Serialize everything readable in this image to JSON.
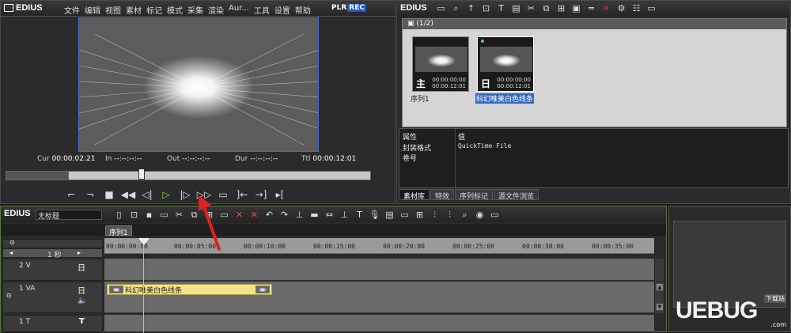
{
  "player": {
    "logo": "EDIUS",
    "menu": [
      "文件",
      "编辑",
      "视图",
      "素材",
      "标记",
      "模式",
      "采集",
      "渲染",
      "Aur...",
      "工具",
      "设置",
      "帮助"
    ],
    "plr": "PLR",
    "rec": "REC",
    "window_buttons": [
      "_",
      "□",
      "×"
    ],
    "timecodes": {
      "cur_label": "Cur",
      "cur": "00:00:02:21",
      "in_label": "In",
      "in": "--:--:--:--",
      "out_label": "Out",
      "out": "--:--:--:--",
      "dur_label": "Dur",
      "dur": "--:--:--:--",
      "ttl_label": "Ttl",
      "ttl": "00:00:12:01"
    },
    "scrub_fraction": 0.38,
    "transport_icons": [
      "mark-in-icon",
      "mark-out-icon",
      "stop-icon",
      "rewind-icon",
      "step-back-icon",
      "play-icon",
      "step-forward-icon",
      "fast-forward-icon",
      "loop-icon",
      "insert-icon",
      "overwrite-icon",
      "output-icon"
    ]
  },
  "bin": {
    "logo": "EDIUS",
    "header": "▣ (1/2)",
    "clips": [
      {
        "name": "序列1",
        "glyph": "主",
        "tc1": "00:00:00;00",
        "tc2": "00:00:12:01",
        "selected": false
      },
      {
        "name": "科幻唯美白色线条",
        "glyph": "日",
        "tc1": "00:00:00;00",
        "tc2": "00:00:12:01",
        "selected": true
      }
    ],
    "props": {
      "col1_header": "属性",
      "col2_header": "值",
      "rows": [
        {
          "key": "封装格式",
          "value": "QuickTime File"
        },
        {
          "key": "卷号",
          "value": ""
        }
      ]
    },
    "tabs": [
      "素材库",
      "特效",
      "序列标记",
      "源文件浏览"
    ]
  },
  "timeline": {
    "logo": "EDIUS",
    "project_name": "无标题",
    "sequence_tab": "序列1",
    "zoom_label": "1 秒",
    "ruler": [
      "00:00:00:00",
      "00:00:05:00",
      "00:00:10:00",
      "00:00:15:00",
      "00:00:20:00",
      "00:00:25:00",
      "00:00:30:00",
      "00:00:35:00"
    ],
    "tracks": [
      {
        "label": "2 V",
        "type": "V"
      },
      {
        "label": "1 VA",
        "type": "VA"
      },
      {
        "label": "1 T",
        "type": "T"
      }
    ],
    "clip_name": "科幻唯美白色线条"
  },
  "watermark": {
    "text": "UEBUG",
    "sub": "下载站",
    "url": ".com"
  },
  "colors": {
    "accent": "#1f57d6",
    "clip": "#f2e38c",
    "selection": "#3169c6",
    "annotation": "#e02020"
  }
}
